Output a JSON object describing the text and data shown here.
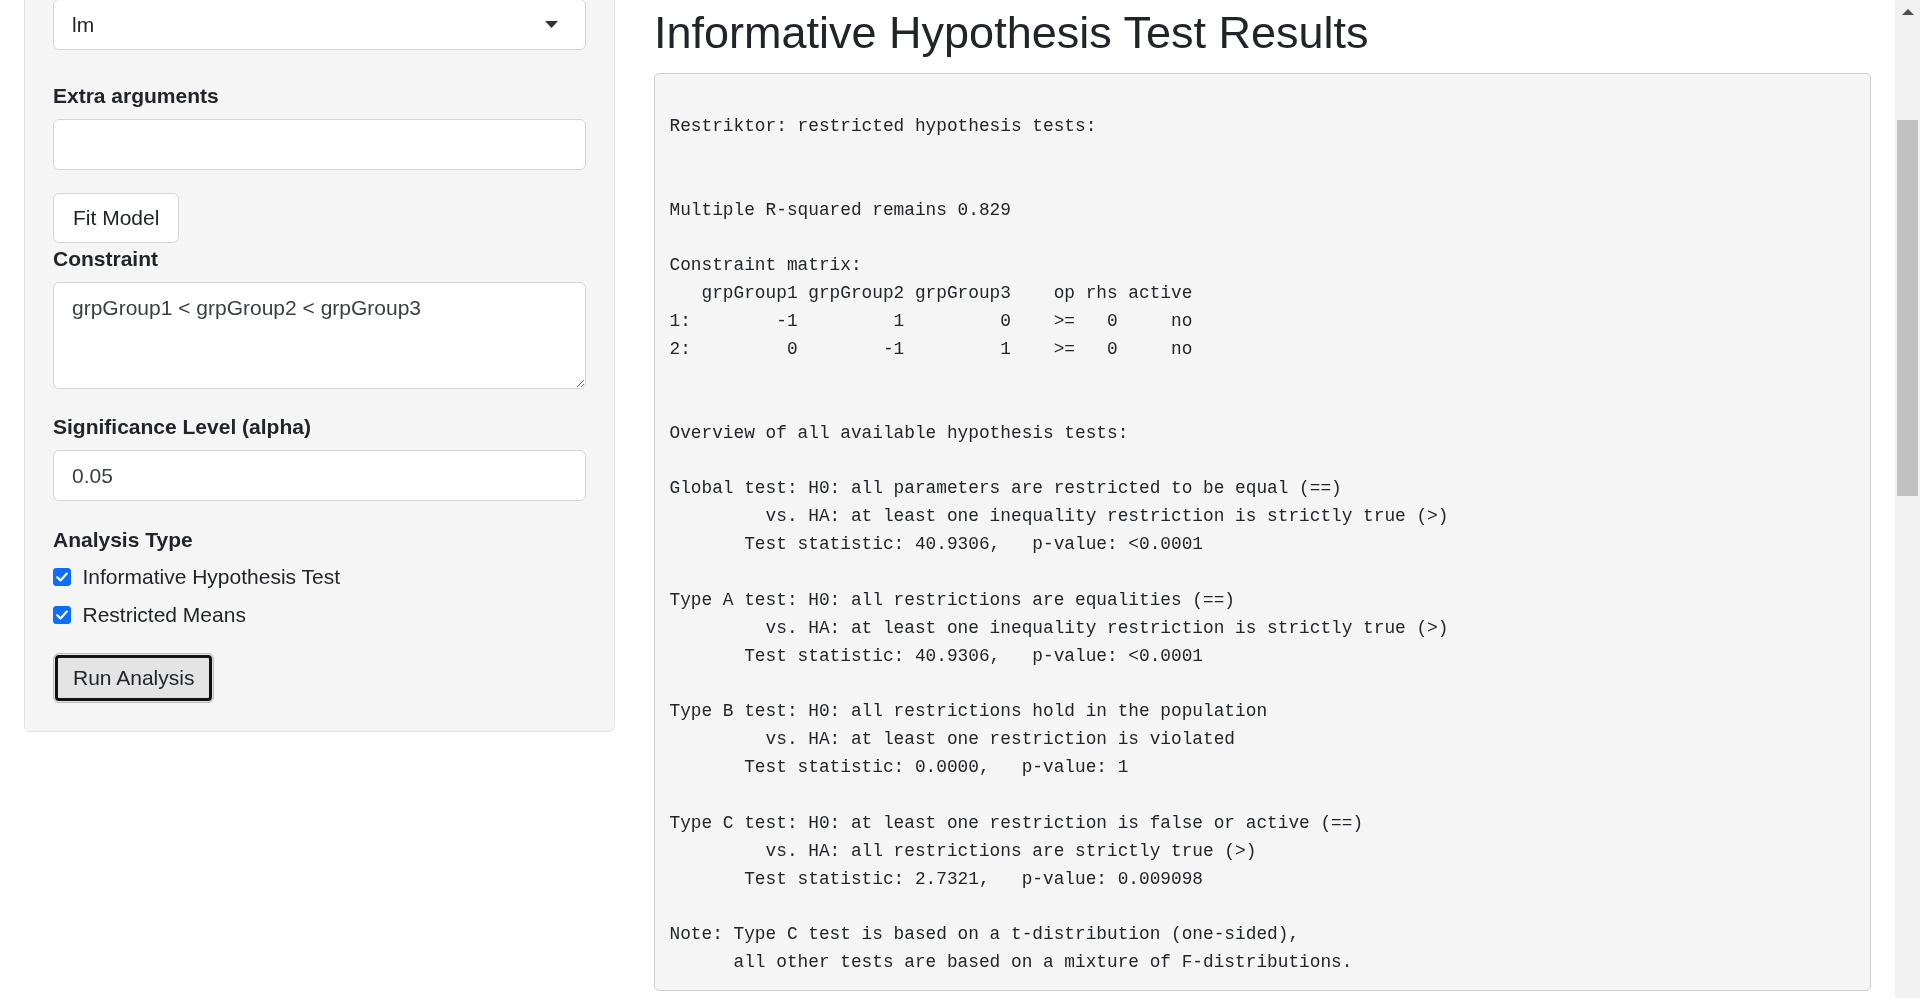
{
  "sidebar": {
    "controls": [
      {
        "kind": "select",
        "value": "lm"
      },
      {
        "kind": "text_input",
        "label": "Extra arguments"
      },
      {
        "kind": "button",
        "label": "Fit Model",
        "focused": false
      },
      {
        "kind": "textarea",
        "label": "Constraint",
        "value": "grpGroup1 < grpGroup2 < grpGroup3"
      },
      {
        "kind": "text_input",
        "label": "Significance Level (alpha)",
        "value": "0.05"
      },
      {
        "kind": "checkbox_group",
        "label": "Analysis Type",
        "options": [
          {
            "label": "Informative Hypothesis Test",
            "checked": true
          },
          {
            "label": "Restricted Means",
            "checked": true
          }
        ]
      },
      {
        "kind": "button",
        "label": "Run Analysis",
        "focused": true
      }
    ]
  },
  "main": {
    "title": "Informative Hypothesis Test Results",
    "output": {
      "sections": [
        {
          "blocks": [
            {
              "lines": [
                "Restriktor: restricted hypothesis tests:"
              ]
            }
          ]
        },
        {
          "blocks": [
            {
              "lines": [
                "Multiple R-squared remains 0.829"
              ]
            },
            {
              "lines": [
                "Constraint matrix:",
                "   grpGroup1 grpGroup2 grpGroup3    op rhs active",
                "1:        -1         1         0    >=   0     no",
                "2:         0        -1         1    >=   0     no"
              ]
            }
          ]
        },
        {
          "blocks": [
            {
              "lines": [
                "Overview of all available hypothesis tests:"
              ]
            },
            {
              "lines": [
                "Global test: H0: all parameters are restricted to be equal (==)",
                "         vs. HA: at least one inequality restriction is strictly true (>)",
                "       Test statistic: 40.9306,   p-value: <0.0001"
              ]
            },
            {
              "lines": [
                "Type A test: H0: all restrictions are equalities (==)",
                "         vs. HA: at least one inequality restriction is strictly true (>)",
                "       Test statistic: 40.9306,   p-value: <0.0001"
              ]
            },
            {
              "lines": [
                "Type B test: H0: all restrictions hold in the population",
                "         vs. HA: at least one restriction is violated",
                "       Test statistic: 0.0000,   p-value: 1"
              ]
            },
            {
              "lines": [
                "Type C test: H0: at least one restriction is false or active (==)",
                "         vs. HA: all restrictions are strictly true (>)",
                "       Test statistic: 2.7321,   p-value: 0.009098"
              ]
            },
            {
              "lines": [
                "Note: Type C test is based on a t-distribution (one-sided),",
                "      all other tests are based on a mixture of F-distributions."
              ]
            }
          ]
        }
      ]
    }
  }
}
